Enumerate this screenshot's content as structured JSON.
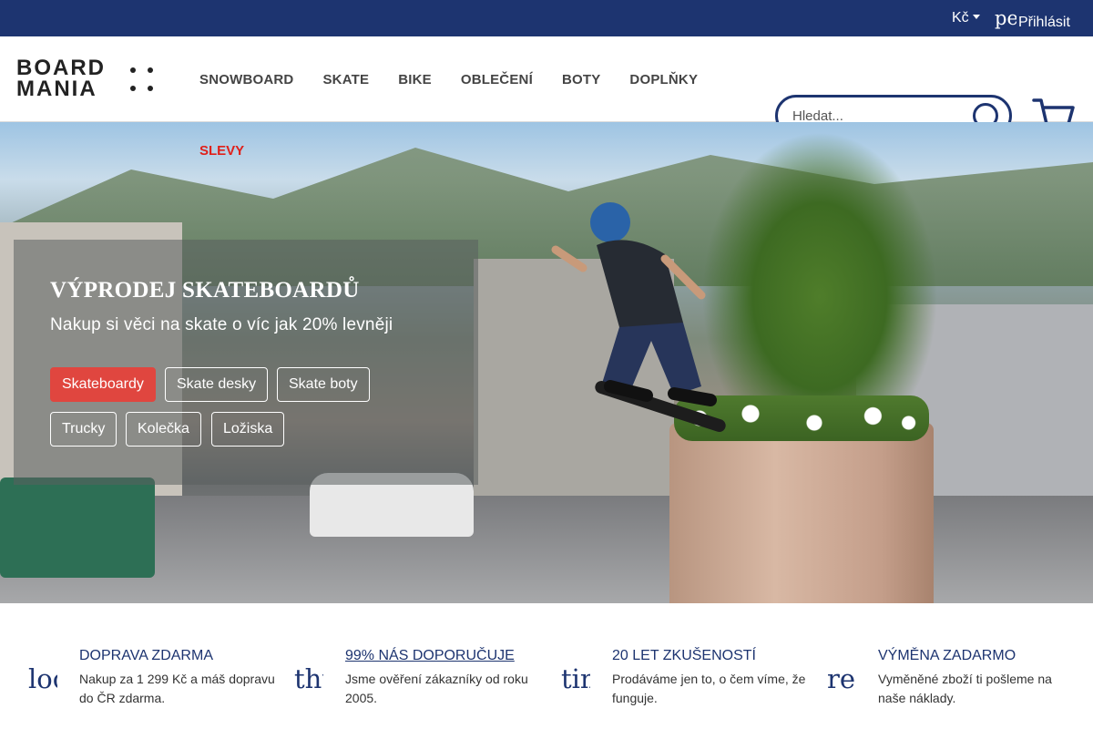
{
  "topbar": {
    "currency": "Kč",
    "login_icon_text": "pe",
    "login_label": "Přihlásit"
  },
  "logo": {
    "line1": "BOARD",
    "line2": "MANIA"
  },
  "nav": {
    "items": [
      "SNOWBOARD",
      "SKATE",
      "BIKE",
      "OBLEČENÍ",
      "BOTY",
      "DOPLŇKY"
    ],
    "extra": "SLEVY"
  },
  "search": {
    "placeholder": "Hledat..."
  },
  "hero": {
    "title": "VÝPRODEJ SKATEBOARDŮ",
    "subtitle": "Nakup si věci na skate o víc jak 20% levněji",
    "chips": [
      "Skateboardy",
      "Skate desky",
      "Skate boty",
      "Trucky",
      "Kolečka",
      "Ložiska"
    ],
    "active_chip": "Skateboardy"
  },
  "features": [
    {
      "icon": "local_shipping",
      "title": "DOPRAVA ZDARMA",
      "desc": "Nakup za 1 299 Kč a máš dopravu do ČR zdarma."
    },
    {
      "icon": "thumb_up",
      "title": "99% NÁS DOPORUČUJE",
      "desc": "Jsme ověření zákazníky od roku 2005."
    },
    {
      "icon": "timer",
      "title": "20 LET ZKUŠENOSTÍ",
      "desc": "Prodáváme jen to, o čem víme, že funguje."
    },
    {
      "icon": "refresh",
      "title": "VÝMĚNA ZADARMO",
      "desc": "Vyměněné zboží ti pošleme na naše náklady."
    }
  ],
  "colors": {
    "brand": "#1d3470",
    "accent": "#e0463f",
    "sale": "#e0201a"
  }
}
